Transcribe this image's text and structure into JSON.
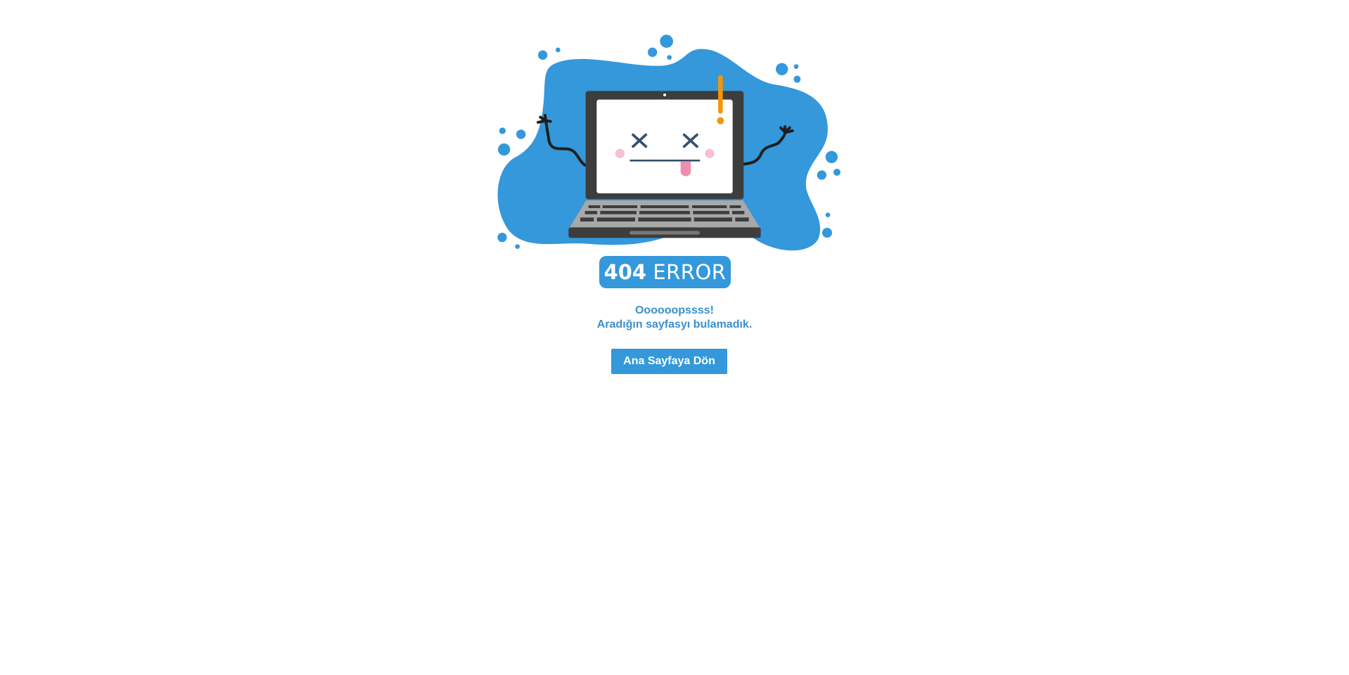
{
  "error": {
    "code": "404",
    "word": "ERROR"
  },
  "message": {
    "line1": "Oooooopssss!",
    "line2": "Aradığın sayfasyı bulamadık."
  },
  "home_button": {
    "label": "Ana Sayfaya Dön"
  },
  "colors": {
    "accent": "#3498db",
    "laptop": "#3d3d3d",
    "keyboard": "#a8a8a8",
    "exclamation": "#f0960e",
    "face": "#34506b",
    "tongue": "#ee8fb0"
  }
}
